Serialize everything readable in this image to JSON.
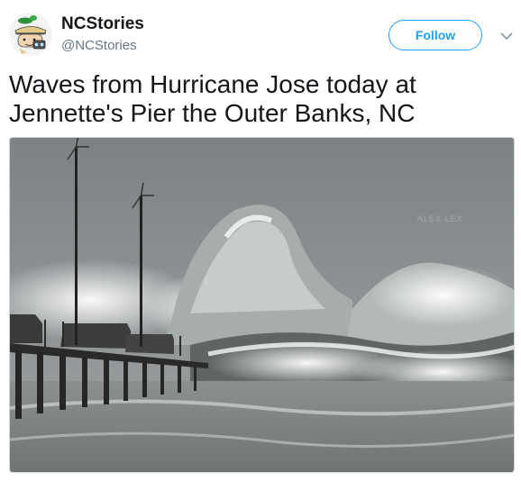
{
  "author": {
    "display_name": "NCStories",
    "handle": "@NCStories",
    "avatar_icon": "cartoon-explorer-avatar-icon"
  },
  "actions": {
    "follow_label": "Follow",
    "more_icon": "chevron-down-icon"
  },
  "tweet": {
    "text": "Waves from Hurricane Jose today at Jennette's Pier the Outer Banks, NC"
  },
  "media": {
    "watermark": "ALEX LEX"
  },
  "colors": {
    "accent": "#1da1f2",
    "text": "#14171a",
    "muted": "#657786"
  }
}
